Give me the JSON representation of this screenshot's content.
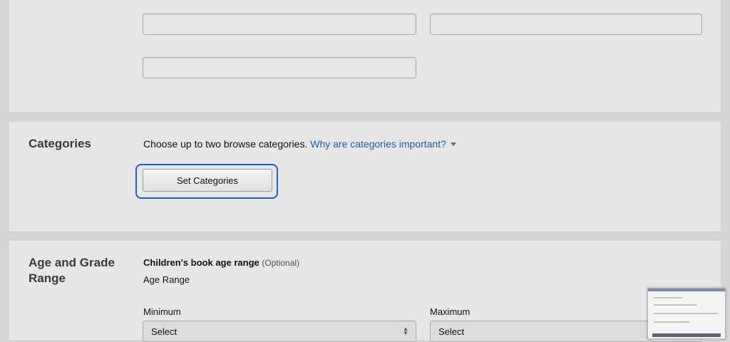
{
  "categories": {
    "heading": "Categories",
    "help_text": "Choose up to two browse categories.",
    "help_link": "Why are categories important?",
    "button_label": "Set Categories"
  },
  "age_grade": {
    "heading": "Age and Grade Range",
    "subheading": "Children's book age range",
    "optional": "(Optional)",
    "age_range_label": "Age Range",
    "minimum_label": "Minimum",
    "maximum_label": "Maximum",
    "minimum_value": "Select",
    "maximum_value": "Select"
  },
  "colors": {
    "page_background": "#d6d6d6",
    "panel_background": "#e6e6e6",
    "link": "#1f5ea8",
    "focus_ring": "#1c5fd6"
  },
  "icons": {
    "help_toggle": "caret-down-icon",
    "select_arrows": "updown-arrows-icon"
  }
}
